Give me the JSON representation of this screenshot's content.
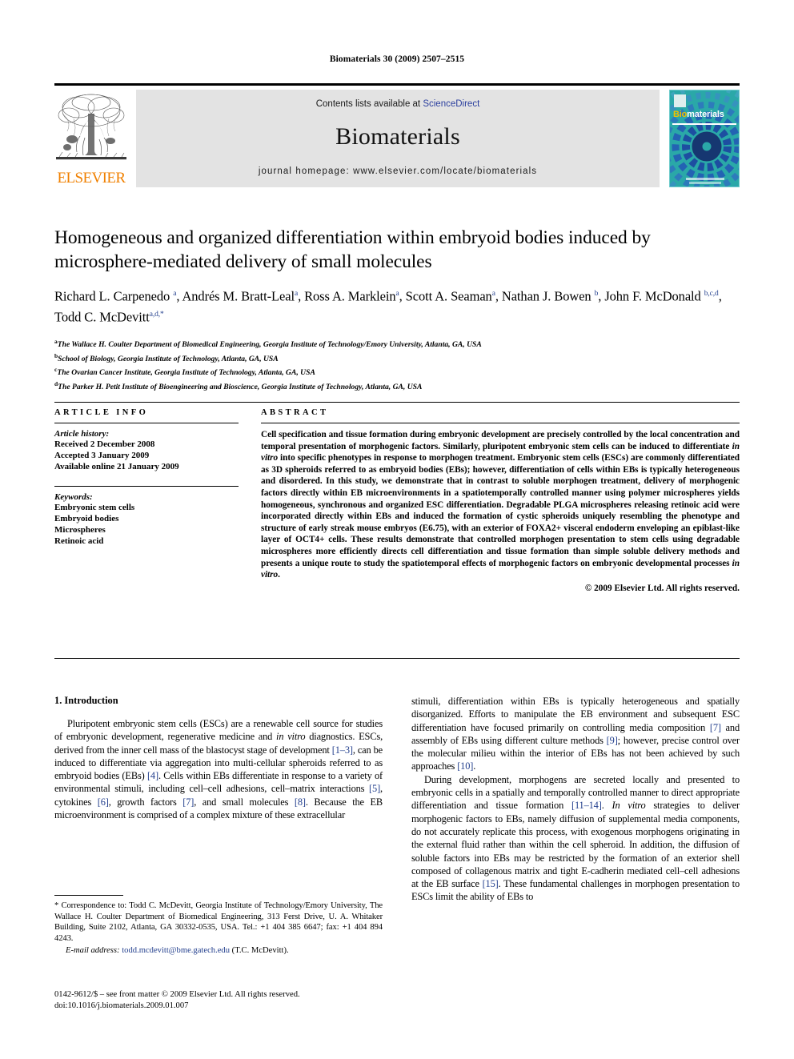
{
  "running_head": "Biomaterials 30 (2009) 2507–2515",
  "banner": {
    "contents_prefix": "Contents lists available at ",
    "contents_link": "ScienceDirect",
    "journal_title": "Biomaterials",
    "homepage": "journal homepage: www.elsevier.com/locate/biomaterials",
    "publisher_name": "ELSEVIER",
    "cover_title_bio": "Bio",
    "cover_title_materials": "materials",
    "accent_link_color": "#2b3f9e",
    "publisher_color": "#f08000",
    "cover_color": "#2aa8a8",
    "banner_bg": "#e3e3e3"
  },
  "title": "Homogeneous and organized differentiation within embryoid bodies induced by microsphere-mediated delivery of small molecules",
  "authors_html": "Richard L. Carpenedo <sup>a</sup>, Andrés M. Bratt-Leal<sup>a</sup>, Ross A. Marklein<sup>a</sup>, Scott A. Seaman<sup>a</sup>, Nathan J. Bowen <sup>b</sup>, John F. McDonald <sup>b,c,d</sup>, Todd C. McDevitt<sup>a,d,</sup><sup>*</sup>",
  "affiliations": [
    {
      "mark": "a",
      "text": "The Wallace H. Coulter Department of Biomedical Engineering, Georgia Institute of Technology/Emory University, Atlanta, GA, USA"
    },
    {
      "mark": "b",
      "text": "School of Biology, Georgia Institute of Technology, Atlanta, GA, USA"
    },
    {
      "mark": "c",
      "text": "The Ovarian Cancer Institute, Georgia Institute of Technology, Atlanta, GA, USA"
    },
    {
      "mark": "d",
      "text": "The Parker H. Petit Institute of Bioengineering and Bioscience, Georgia Institute of Technology, Atlanta, GA, USA"
    }
  ],
  "article_info": {
    "heading": "ARTICLE INFO",
    "history_label": "Article history:",
    "history": [
      "Received 2 December 2008",
      "Accepted 3 January 2009",
      "Available online 21 January 2009"
    ],
    "keywords_label": "Keywords:",
    "keywords": [
      "Embryonic stem cells",
      "Embryoid bodies",
      "Microspheres",
      "Retinoic acid"
    ]
  },
  "abstract": {
    "heading": "ABSTRACT",
    "paragraph_html": "Cell specification and tissue formation during embryonic development are precisely controlled by the local concentration and temporal presentation of morphogenic factors. Similarly, pluripotent embryonic stem cells can be induced to differentiate <i>in vitro</i> into specific phenotypes in response to morphogen treatment. Embryonic stem cells (ESCs) are commonly differentiated as 3D spheroids referred to as embryoid bodies (EBs); however, differentiation of cells within EBs is typically heterogeneous and disordered. In this study, we demonstrate that in contrast to soluble morphogen treatment, delivery of morphogenic factors directly within EB microenvironments in a spatiotemporally controlled manner using polymer microspheres yields homogeneous, synchronous and organized ESC differentiation. Degradable PLGA microspheres releasing retinoic acid were incorporated directly within EBs and induced the formation of cystic spheroids uniquely resembling the phenotype and structure of early streak mouse embryos (E6.75), with an exterior of FOXA2+ visceral endoderm enveloping an epiblast-like layer of OCT4+ cells. These results demonstrate that controlled morphogen presentation to stem cells using degradable microspheres more efficiently directs cell differentiation and tissue formation than simple soluble delivery methods and presents a unique route to study the spatiotemporal effects of morphogenic factors on embryonic developmental processes <i>in vitro</i>.",
    "copyright": "© 2009 Elsevier Ltd. All rights reserved."
  },
  "introduction": {
    "section_title": "1. Introduction",
    "left_paragraph_html": "Pluripotent embryonic stem cells (ESCs) are a renewable cell source for studies of embryonic development, regenerative medicine and <i>in vitro</i> diagnostics. ESCs, derived from the inner cell mass of the blastocyst stage of development <span class=\"ref\">[1–3]</span>, can be induced to differentiate via aggregation into multi-cellular spheroids referred to as embryoid bodies (EBs) <span class=\"ref\">[4]</span>. Cells within EBs differentiate in response to a variety of environmental stimuli, including cell–cell adhesions, cell–matrix interactions <span class=\"ref\">[5]</span>, cytokines <span class=\"ref\">[6]</span>, growth factors <span class=\"ref\">[7]</span>, and small molecules <span class=\"ref\">[8]</span>. Because the EB microenvironment is comprised of a complex mixture of these extracellular",
    "right_paragraph1_html": "stimuli, differentiation within EBs is typically heterogeneous and spatially disorganized. Efforts to manipulate the EB environment and subsequent ESC differentiation have focused primarily on controlling media composition <span class=\"ref\">[7]</span> and assembly of EBs using different culture methods <span class=\"ref\">[9]</span>; however, precise control over the molecular milieu within the interior of EBs has not been achieved by such approaches <span class=\"ref\">[10]</span>.",
    "right_paragraph2_html": "During development, morphogens are secreted locally and presented to embryonic cells in a spatially and temporally controlled manner to direct appropriate differentiation and tissue formation <span class=\"ref\">[11–14]</span>. <i>In vitro</i> strategies to deliver morphogenic factors to EBs, namely diffusion of supplemental media components, do not accurately replicate this process, with exogenous morphogens originating in the external fluid rather than within the cell spheroid. In addition, the diffusion of soluble factors into EBs may be restricted by the formation of an exterior shell composed of collagenous matrix and tight E-cadherin mediated cell–cell adhesions at the EB surface <span class=\"ref\">[15]</span>. These fundamental challenges in morphogen presentation to ESCs limit the ability of EBs to"
  },
  "footnote": {
    "correspondence_html": "* Correspondence to: Todd C. McDevitt, Georgia Institute of Technology/Emory University, The Wallace H. Coulter Department of Biomedical Engineering, 313 Ferst Drive, U. A. Whitaker Building, Suite 2102, Atlanta, GA 30332-0535, USA. Tel.: +1 404 385 6647; fax: +1 404 894 4243.",
    "email_label": "E-mail address:",
    "email": "todd.mcdevitt@bme.gatech.edu",
    "email_owner": "(T.C. McDevitt)."
  },
  "imprint": {
    "line1": "0142-9612/$ – see front matter © 2009 Elsevier Ltd. All rights reserved.",
    "line2": "doi:10.1016/j.biomaterials.2009.01.007"
  }
}
